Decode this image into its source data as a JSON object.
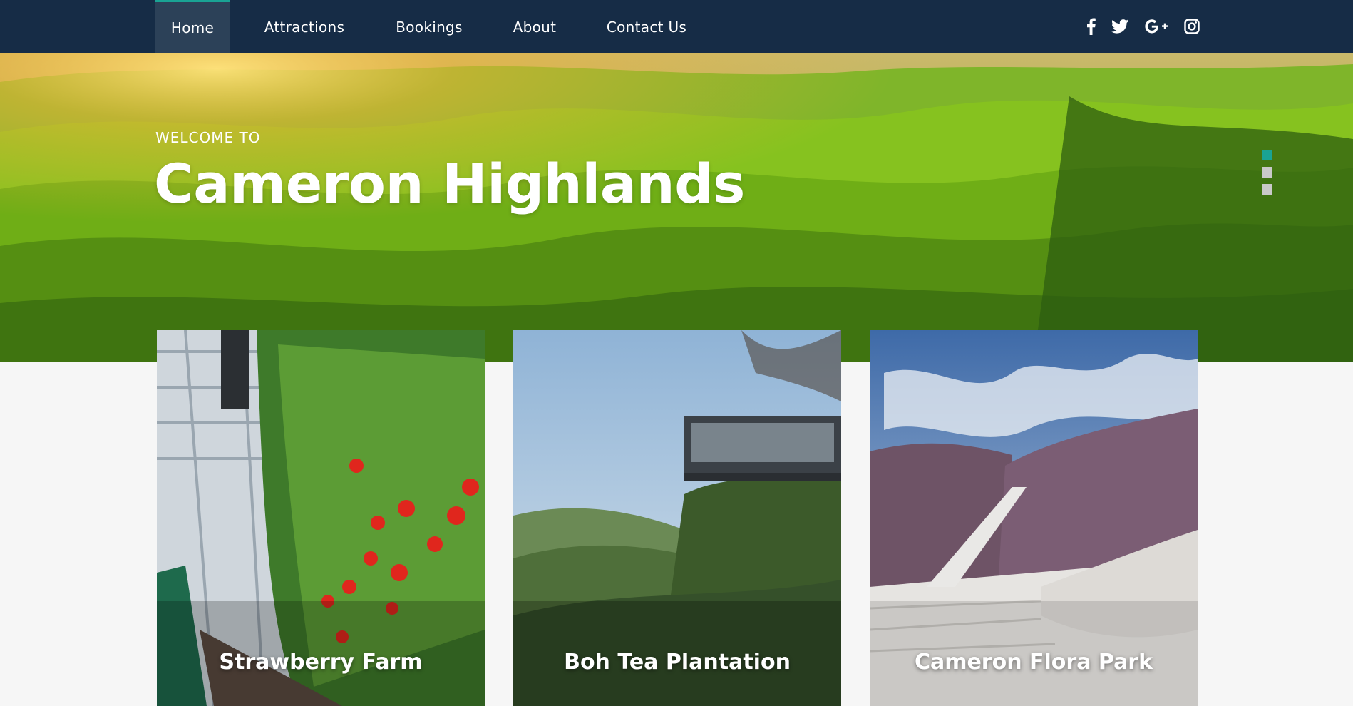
{
  "nav": {
    "items": [
      {
        "label": "Home",
        "active": true
      },
      {
        "label": "Attractions",
        "active": false
      },
      {
        "label": "Bookings",
        "active": false
      },
      {
        "label": "About",
        "active": false
      },
      {
        "label": "Contact Us",
        "active": false
      }
    ],
    "social": [
      {
        "icon": "facebook-icon",
        "glyph": "f"
      },
      {
        "icon": "twitter-icon",
        "glyph": "twitter"
      },
      {
        "icon": "google-plus-icon",
        "glyph": "G+"
      },
      {
        "icon": "instagram-icon",
        "glyph": "instagram"
      }
    ],
    "background_color": "#162c46",
    "accent_color": "#1aa394"
  },
  "hero": {
    "kicker": "WELCOME TO",
    "title": "Cameron Highlands",
    "slider_dots": [
      {
        "active": true
      },
      {
        "active": false
      },
      {
        "active": false
      }
    ]
  },
  "cards": [
    {
      "label": "Strawberry Farm",
      "image": "strawberry-farm-photo"
    },
    {
      "label": "Boh Tea Plantation",
      "image": "boh-tea-plantation-photo"
    },
    {
      "label": "Cameron Flora Park",
      "image": "cameron-flora-park-photo"
    }
  ]
}
